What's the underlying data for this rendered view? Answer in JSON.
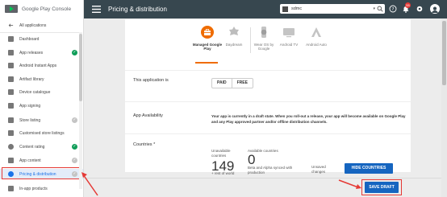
{
  "app": {
    "brand": "Google Play Console"
  },
  "sidebar": {
    "all_apps": "All applications",
    "items": [
      {
        "label": "Dashboard",
        "status": ""
      },
      {
        "label": "App releases",
        "status": "done"
      },
      {
        "label": "Android Instant Apps",
        "status": ""
      },
      {
        "label": "Artifact library",
        "status": ""
      },
      {
        "label": "Device catalogue",
        "status": ""
      },
      {
        "label": "App signing",
        "status": ""
      },
      {
        "label": "Store listing",
        "status": "pending"
      },
      {
        "label": "Customised store listings",
        "status": ""
      },
      {
        "label": "Content rating",
        "status": "done"
      },
      {
        "label": "App content",
        "status": "pending"
      },
      {
        "label": "Pricing & distribution",
        "status": "pending"
      },
      {
        "label": "In-app products",
        "status": ""
      }
    ]
  },
  "header": {
    "title": "Pricing & distribution",
    "app_name": "sdmc",
    "notification_count": "55"
  },
  "devices": [
    {
      "label": "Managed Google Play",
      "selected": true
    },
    {
      "label": "Daydream",
      "selected": false
    },
    {
      "label": "Wear OS by Google",
      "selected": false
    },
    {
      "label": "Android TV",
      "selected": false
    },
    {
      "label": "Android Auto",
      "selected": false
    }
  ],
  "pricing": {
    "label": "This application is",
    "paid": "PAID",
    "free": "FREE"
  },
  "availability": {
    "label": "App Availability",
    "text": "Your app is currently in a draft state. When you roll-out a release, your app will become available on Google Play and any Play approved partner and/or offline distribution channels."
  },
  "countries": {
    "label": "Countries *",
    "unavailable_label": "Unavailable countries",
    "unavailable_count": "149",
    "unavailable_sub": "+ rest of world",
    "available_label": "Available countries",
    "available_count": "0",
    "available_sub": "Beta and Alpha synced with production",
    "unsaved": "Unsaved changes",
    "hide_button": "HIDE COUNTRIES"
  },
  "footer": {
    "save_button": "SAVE DRAFT"
  },
  "colors": {
    "accent": "#1565c0",
    "header": "#37474f",
    "highlight": "#e53935",
    "managed": "#ef6c00",
    "success": "#0f9d58"
  }
}
